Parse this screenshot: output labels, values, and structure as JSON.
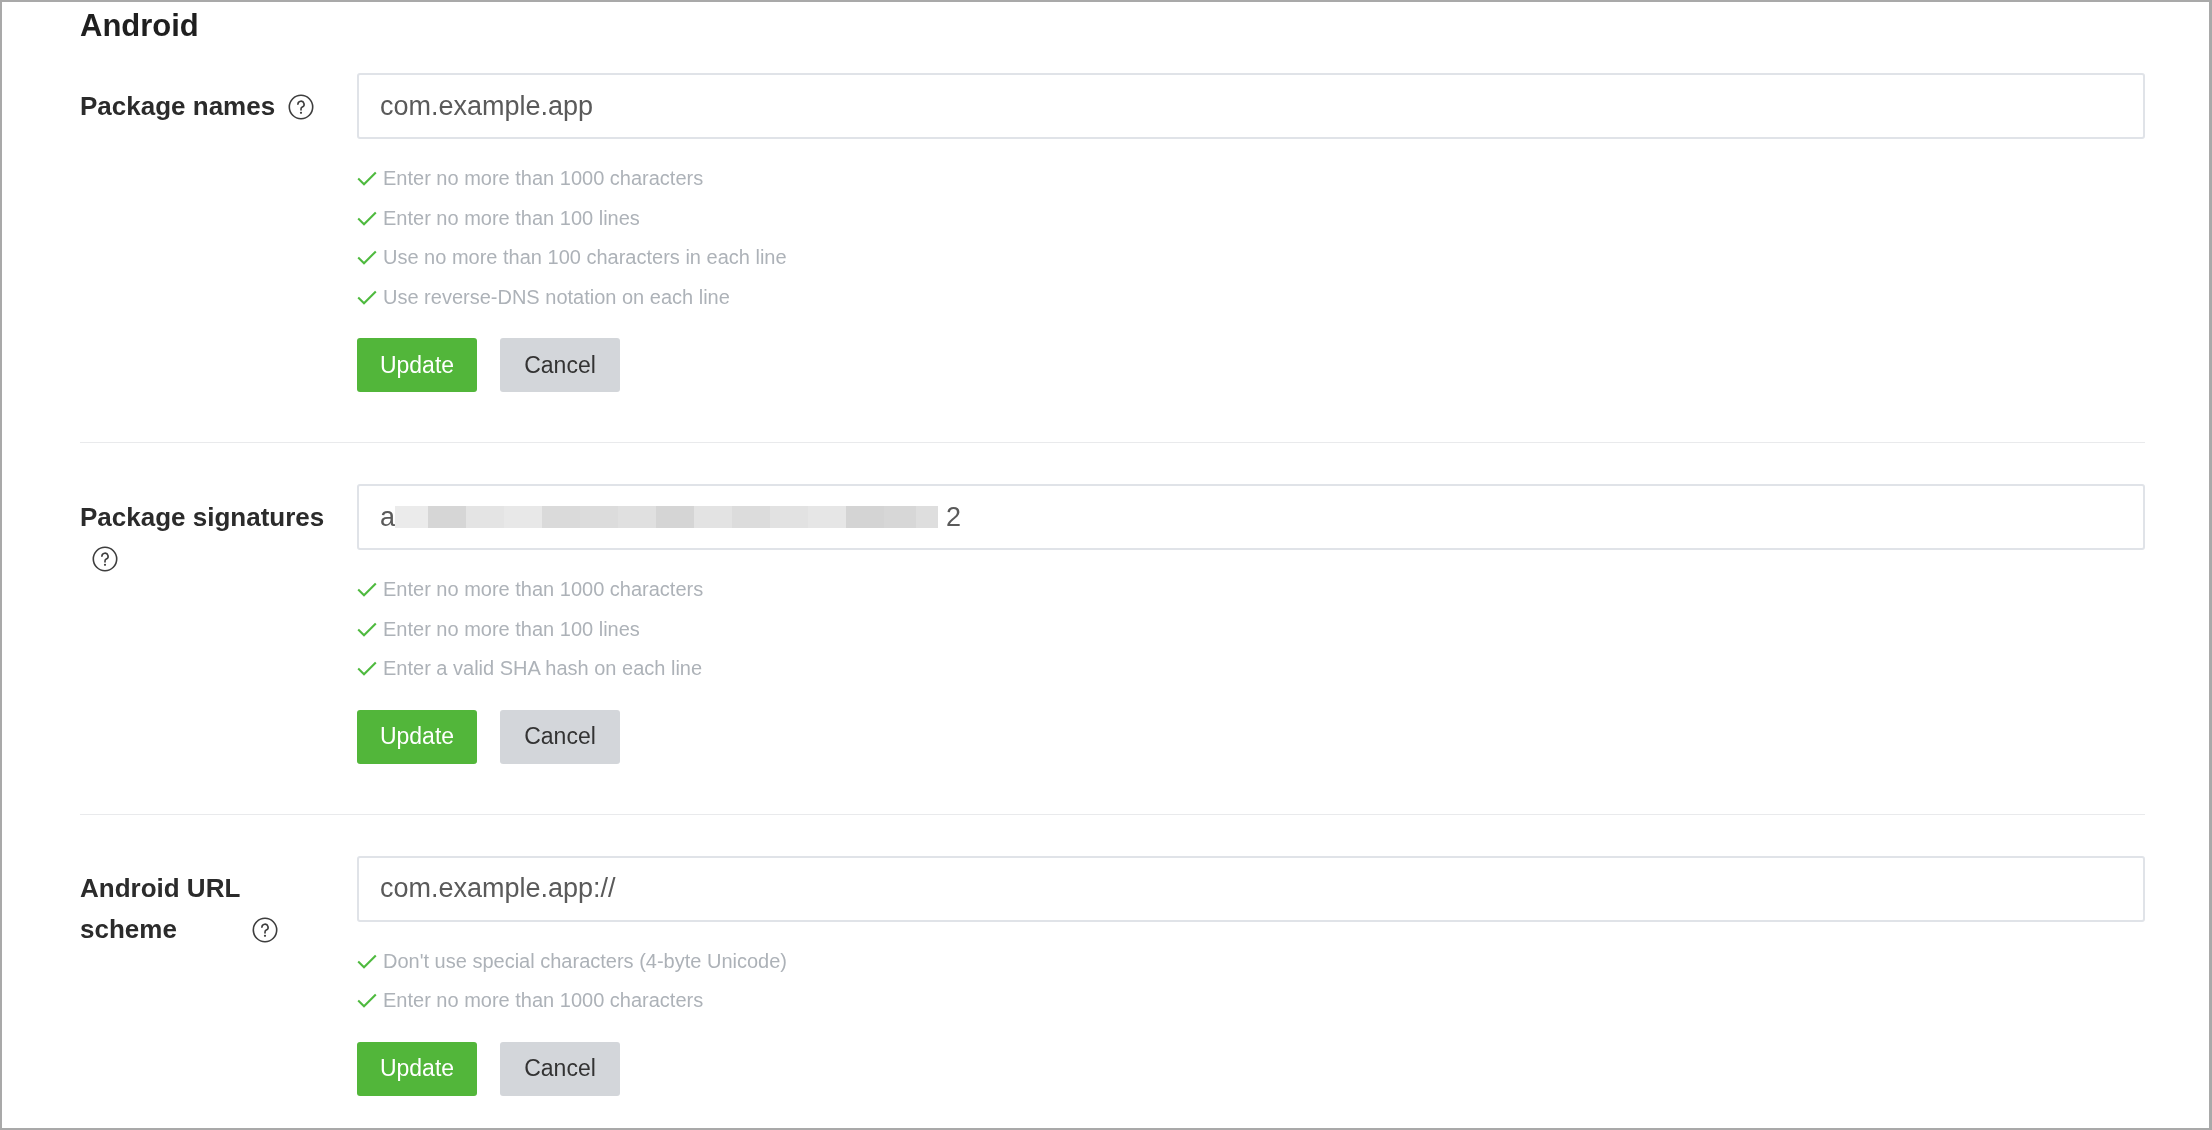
{
  "title": "Android",
  "sections": [
    {
      "label": "Package names",
      "field": {
        "segments": [
          {
            "kind": "text",
            "text": "com.example.app"
          }
        ]
      },
      "checks": [
        {
          "text": "Enter no more than 1000 characters",
          "passed": true
        },
        {
          "text": "Enter no more than 100 lines",
          "passed": true
        },
        {
          "text": "Use no more than 100 characters in each line",
          "passed": true
        },
        {
          "text": "Use reverse-DNS notation on each line",
          "passed": true
        }
      ],
      "buttons": [
        {
          "label": "Update",
          "kind": "primary"
        },
        {
          "label": "Cancel",
          "kind": "secondary"
        }
      ]
    },
    {
      "label": "Package signatures",
      "field": {
        "segments": [
          {
            "kind": "text",
            "text": "a"
          },
          {
            "kind": "redacted"
          },
          {
            "kind": "text",
            "text": "2"
          }
        ]
      },
      "checks": [
        {
          "text": "Enter no more than 1000 characters",
          "passed": true
        },
        {
          "text": "Enter no more than 100 lines",
          "passed": true
        },
        {
          "text": "Enter a valid SHA hash on each line",
          "passed": true
        }
      ],
      "buttons": [
        {
          "label": "Update",
          "kind": "primary"
        },
        {
          "label": "Cancel",
          "kind": "secondary"
        }
      ]
    },
    {
      "label": "Android URL scheme",
      "field": {
        "segments": [
          {
            "kind": "text",
            "text": "com.example.app://"
          }
        ]
      },
      "checks": [
        {
          "text": "Don't use special characters (4-byte Unicode)",
          "passed": true
        },
        {
          "text": "Enter no more than 1000 characters",
          "passed": true
        }
      ],
      "buttons": [
        {
          "label": "Update",
          "kind": "primary"
        },
        {
          "label": "Cancel",
          "kind": "secondary"
        }
      ]
    }
  ]
}
